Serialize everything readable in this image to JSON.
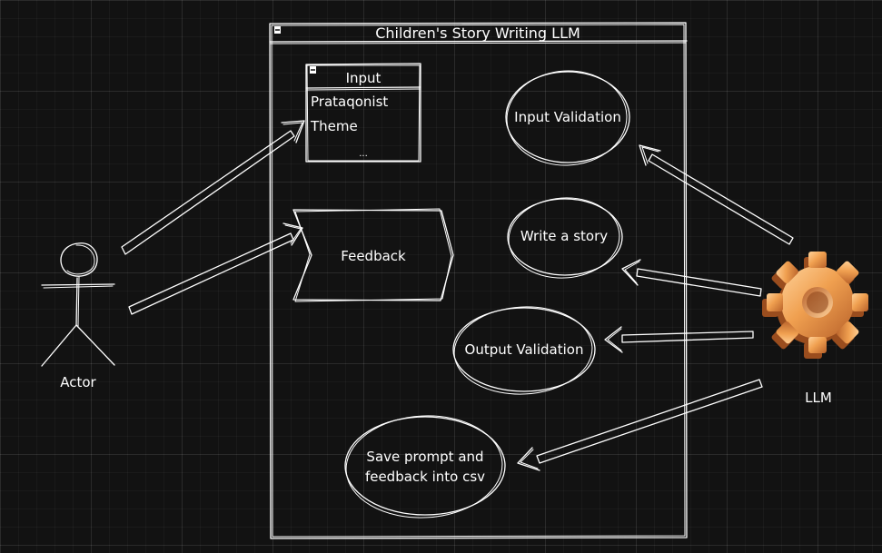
{
  "diagram": {
    "system_title": "Children's Story Writing LLM",
    "input_box": {
      "title": "Input",
      "fields": [
        "Prataqonist",
        "Theme",
        "..."
      ]
    },
    "feedback_label": "Feedback",
    "use_cases": {
      "input_validation": "Input Validation",
      "write_story": "Write a story",
      "output_validation": "Output Validation",
      "save_line1": "Save prompt and",
      "save_line2": "feedback into csv"
    },
    "actors": {
      "user": "Actor",
      "llm": "LLM"
    },
    "colors": {
      "background": "#121212",
      "stroke": "#ffffff",
      "gear": "#f0a050"
    },
    "icons": {
      "actor": "stick-figure-icon",
      "llm": "gear-icon"
    }
  }
}
